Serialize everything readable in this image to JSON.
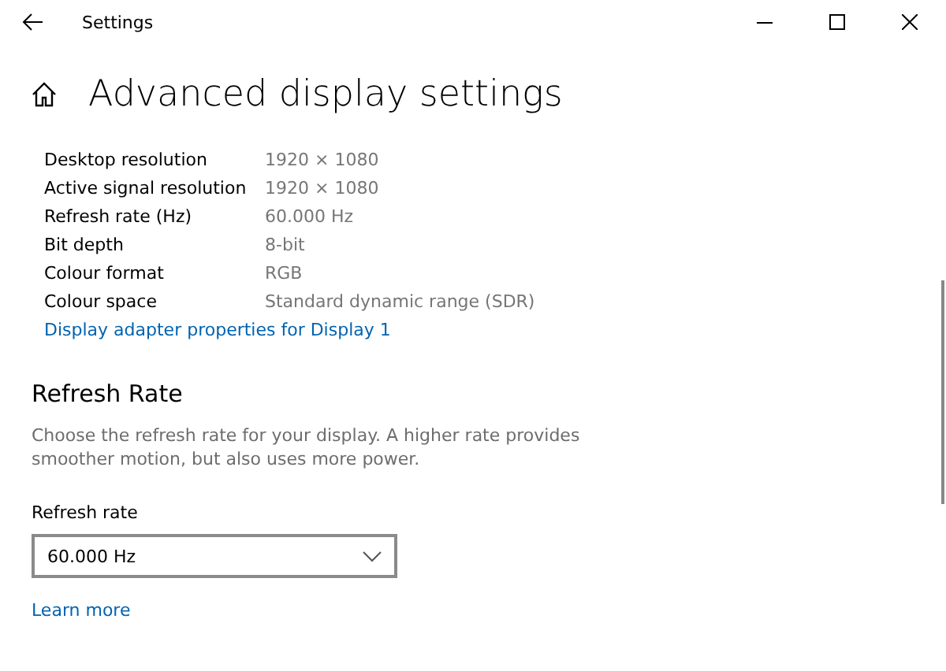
{
  "window": {
    "title": "Settings"
  },
  "page": {
    "title": "Advanced display settings"
  },
  "display_info": [
    {
      "label": "Desktop resolution",
      "value": "1920 × 1080"
    },
    {
      "label": "Active signal resolution",
      "value": "1920 × 1080"
    },
    {
      "label": "Refresh rate (Hz)",
      "value": "60.000 Hz"
    },
    {
      "label": "Bit depth",
      "value": "8-bit"
    },
    {
      "label": "Colour format",
      "value": "RGB"
    },
    {
      "label": "Colour space",
      "value": "Standard dynamic range (SDR)"
    }
  ],
  "adapter_link": "Display adapter properties for Display 1",
  "refresh_section": {
    "heading": "Refresh Rate",
    "description": "Choose the refresh rate for your display. A higher rate provides smoother motion, but also uses more power.",
    "field_label": "Refresh rate",
    "dropdown_value": "60.000 Hz",
    "learn_more": "Learn more"
  }
}
